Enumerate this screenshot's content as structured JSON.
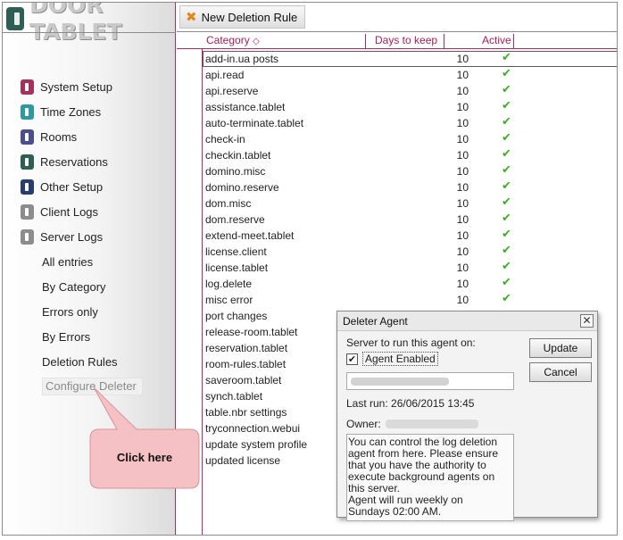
{
  "app": {
    "logo_text": "DOOR TABLET"
  },
  "toolbar": {
    "new_rule_label": "New Deletion Rule"
  },
  "sidebar": {
    "items": [
      {
        "label": "System Setup",
        "color": "#a3315c"
      },
      {
        "label": "Time Zones",
        "color": "#2e9aa0"
      },
      {
        "label": "Rooms",
        "color": "#4a4f8c"
      },
      {
        "label": "Reservations",
        "color": "#2f5e55"
      },
      {
        "label": "Other Setup",
        "color": "#263d6e"
      },
      {
        "label": "Client Logs",
        "color": "#8c8c8c"
      },
      {
        "label": "Server Logs",
        "color": "#8c8c8c"
      }
    ],
    "subitems": [
      {
        "label": "All entries"
      },
      {
        "label": "By Category"
      },
      {
        "label": "Errors only"
      },
      {
        "label": "By Errors"
      },
      {
        "label": "Deletion Rules"
      },
      {
        "label": "Configure Deleter",
        "active": true
      }
    ]
  },
  "table": {
    "headers": {
      "category": "Category",
      "sort_glyph": "◇",
      "days": "Days to keep",
      "active": "Active"
    },
    "rows": [
      {
        "category": "add-in.ua posts",
        "days": "10",
        "active": true
      },
      {
        "category": "api.read",
        "days": "10",
        "active": true
      },
      {
        "category": "api.reserve",
        "days": "10",
        "active": true
      },
      {
        "category": "assistance.tablet",
        "days": "10",
        "active": true
      },
      {
        "category": "auto-terminate.tablet",
        "days": "10",
        "active": true
      },
      {
        "category": "check-in",
        "days": "10",
        "active": true
      },
      {
        "category": "checkin.tablet",
        "days": "10",
        "active": true
      },
      {
        "category": "domino.misc",
        "days": "10",
        "active": true
      },
      {
        "category": "domino.reserve",
        "days": "10",
        "active": true
      },
      {
        "category": "dom.misc",
        "days": "10",
        "active": true
      },
      {
        "category": "dom.reserve",
        "days": "10",
        "active": true
      },
      {
        "category": "extend-meet.tablet",
        "days": "10",
        "active": true
      },
      {
        "category": "license.client",
        "days": "10",
        "active": true
      },
      {
        "category": "license.tablet",
        "days": "10",
        "active": true
      },
      {
        "category": "log.delete",
        "days": "10",
        "active": true
      },
      {
        "category": "misc error",
        "days": "10",
        "active": true
      },
      {
        "category": "port changes",
        "days": "",
        "active": false
      },
      {
        "category": "release-room.tablet",
        "days": "",
        "active": false
      },
      {
        "category": "reservation.tablet",
        "days": "",
        "active": false
      },
      {
        "category": "room-rules.tablet",
        "days": "",
        "active": false
      },
      {
        "category": "saveroom.tablet",
        "days": "",
        "active": false
      },
      {
        "category": "synch.tablet",
        "days": "",
        "active": false
      },
      {
        "category": "table.nbr settings",
        "days": "",
        "active": false
      },
      {
        "category": "tryconnection.webui",
        "days": "",
        "active": false
      },
      {
        "category": "update system profile",
        "days": "",
        "active": false
      },
      {
        "category": "updated license",
        "days": "",
        "active": false
      }
    ],
    "check_glyph": "✔"
  },
  "dialog": {
    "title": "Deleter Agent",
    "close_glyph": "✕",
    "server_label": "Server to run this agent on:",
    "agent_enabled_label": "Agent Enabled",
    "agent_enabled_checked": true,
    "check_glyph": "✔",
    "last_run": "Last run: 26/06/2015 13:45",
    "owner_label": "Owner:",
    "info_lines": [
      "You can control the log deletion",
      "agent from here. Please ensure",
      "that you have the authority to",
      "execute background agents on",
      "this server.",
      "Agent will run weekly on",
      "Sundays 02:00 AM."
    ],
    "update_label": "Update",
    "cancel_label": "Cancel"
  },
  "callout": {
    "text": "Click here",
    "color": "#f6c1c4"
  }
}
